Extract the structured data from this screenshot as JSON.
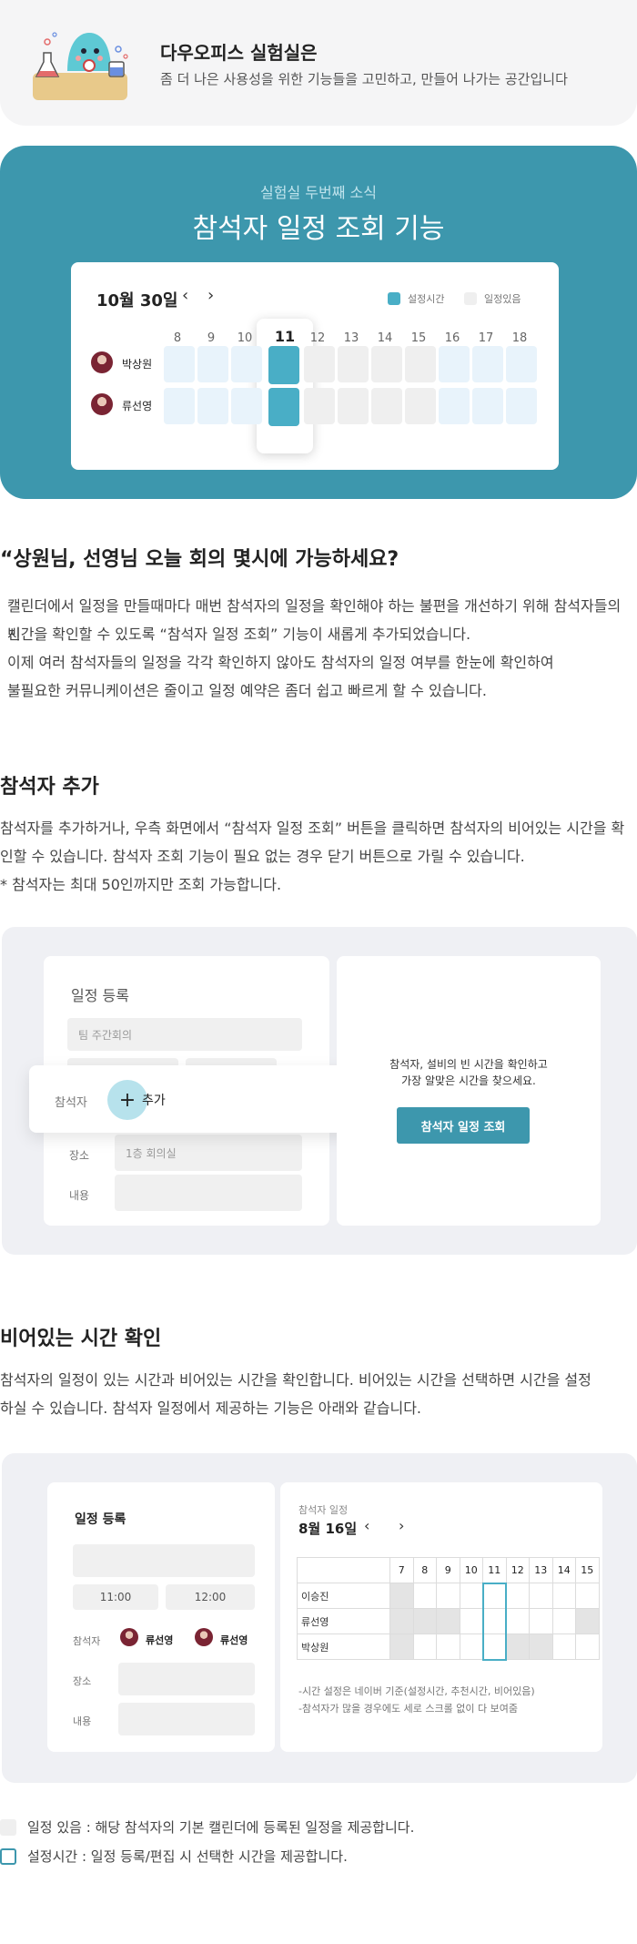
{
  "header": {
    "title": "다우오피스 실험실은",
    "subtitle": "좀 더 나은 사용성을 위한 기능들을 고민하고, 만들어 나가는 공간입니다"
  },
  "banner": {
    "kicker": "실험실 두번째 소식",
    "title": "참석자 일정 조회 기능",
    "calendar": {
      "date": "10월 30일",
      "prev": "‹",
      "next": "›",
      "legend_set": "설정시간",
      "legend_busy": "일정있음",
      "hours": [
        "8",
        "9",
        "10",
        "11",
        "12",
        "13",
        "14",
        "15",
        "16",
        "17",
        "18"
      ],
      "people": [
        "박상원",
        "류선영"
      ]
    }
  },
  "intro": {
    "heading": "“상원님, 선영님 오늘 회의 몇시에 가능하세요?",
    "lines": [
      "캘린더에서 일정을 만들때마다 매번 참석자의 일정을 확인해야 하는 불편을 개선하기 위해 참석자들의 빈",
      "시간을 확인할 수 있도록 “참석자 일정 조회” 기능이 새롭게 추가되었습니다.",
      "이제 여러 참석자들의 일정을 각각 확인하지 않아도 참석자의 일정 여부를 한눈에 확인하여",
      "불필요한 커뮤니케이션은 줄이고 일정 예약은 좀더 쉽고 빠르게 할 수 있습니다."
    ]
  },
  "section_add": {
    "title": "참석자 추가",
    "lines": [
      "참석자를 추가하거나, 우측 화면에서 “참석자 일정 조회” 버튼을 클릭하면 참석자의 비어있는 시간을 확",
      "인할 수 있습니다. 참석자 조회 기능이 필요 없는 경우 닫기 버튼으로 가릴 수 있습니다.",
      "* 참석자는 최대 50인까지만 조회 가능합니다."
    ],
    "form": {
      "title": "일정 등록",
      "event_value": "팀 주간회의",
      "attendee_label": "참석자",
      "add_label": "추가",
      "place_label": "장소",
      "place_value": "1층 회의실",
      "content_label": "내용"
    },
    "side": {
      "message_line1": "참석자, 설비의 빈 시간을 확인하고",
      "message_line2": "가장 알맞은 시간을 찾으세요.",
      "button": "참석자 일정 조회"
    }
  },
  "section_free": {
    "title": "비어있는 시간 확인",
    "lines": [
      "참석자의 일정이 있는 시간과 비어있는 시간을 확인합니다. 비어있는 시간을 선택하면 시간을 설정",
      "하실 수 있습니다. 참석자 일정에서 제공하는 기능은 아래와 같습니다."
    ],
    "form": {
      "title": "일정 등록",
      "start": "11:00",
      "end": "12:00",
      "attendee_label": "참석자",
      "attendee1": "류선영",
      "attendee2": "류선영",
      "place_label": "장소",
      "content_label": "내용"
    },
    "schedule": {
      "caption": "참석자 일정",
      "date": "8월 16일",
      "prev": "‹",
      "next": "›",
      "hours": [
        "7",
        "8",
        "9",
        "10",
        "11",
        "12",
        "13",
        "14",
        "15"
      ],
      "rows": [
        "이승진",
        "류선영",
        "박상원"
      ],
      "note1": "-시간 설정은 네이버 기준(설정시간, 추천시간, 비어있음)",
      "note2": "-참석자가 많을 경우에도 세로 스크롤 없이 다 보여줌"
    }
  },
  "legend": {
    "busy": "일정 있음 : 해당 참석자의 기본 캘린더에 등록된 일정을 제공합니다.",
    "set": "설정시간 : 일정 등록/편집 시 선택한 시간을 제공합니다."
  },
  "colors": {
    "accent": "#3d97ad",
    "selected": "#49aec6",
    "free": "#e8f3fb",
    "busy": "#efefef"
  }
}
